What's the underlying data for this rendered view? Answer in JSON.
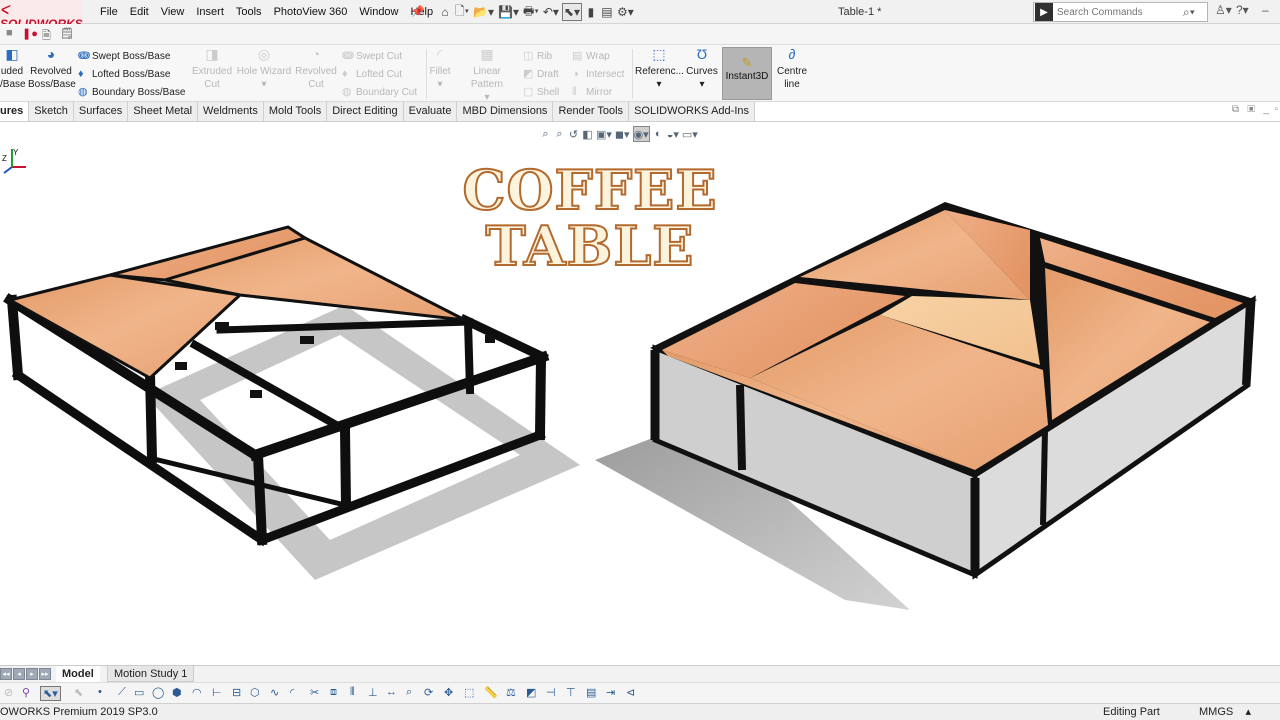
{
  "app": {
    "brand": "SOLIDWORKS",
    "document_title": "Table-1 *",
    "menus": [
      "File",
      "Edit",
      "View",
      "Insert",
      "Tools",
      "PhotoView 360",
      "Window",
      "Help"
    ]
  },
  "search": {
    "placeholder": "Search Commands"
  },
  "ribbon": {
    "extruded_label_1": "uded",
    "extruded_label_2": "/Base",
    "revolved_boss_label_1": "Revolved",
    "revolved_boss_label_2": "Boss/Base",
    "swept_boss": "Swept Boss/Base",
    "lofted_boss": "Lofted Boss/Base",
    "boundary_boss": "Boundary Boss/Base",
    "extruded_cut_1": "Extruded",
    "extruded_cut_2": "Cut",
    "hole_wizard": "Hole Wizard",
    "revolved_cut_1": "Revolved",
    "revolved_cut_2": "Cut",
    "swept_cut": "Swept Cut",
    "lofted_cut": "Lofted Cut",
    "boundary_cut": "Boundary Cut",
    "fillet": "Fillet",
    "linear_pattern": "Linear Pattern",
    "rib": "Rib",
    "draft": "Draft",
    "shell": "Shell",
    "wrap": "Wrap",
    "intersect": "Intersect",
    "mirror": "Mirror",
    "reference": "Referenc...",
    "curves": "Curves",
    "instant3d": "Instant3D",
    "centreline_1": "Centre",
    "centreline_2": "line"
  },
  "command_tabs": [
    "ures",
    "Sketch",
    "Surfaces",
    "Sheet Metal",
    "Weldments",
    "Mold Tools",
    "Direct Editing",
    "Evaluate",
    "MBD Dimensions",
    "Render Tools",
    "SOLIDWORKS Add-Ins"
  ],
  "viewport": {
    "title_line1": "COFFEE",
    "title_line2": "TABLE",
    "triad_label_y": "Y",
    "triad_label_z": "Z"
  },
  "bottom_tabs": {
    "model": "Model",
    "motion": "Motion Study 1"
  },
  "status": {
    "version": "OWORKS Premium 2019 SP3.0",
    "mode": "Editing Part",
    "units": "MMGS"
  },
  "colors": {
    "brand_red": "#c8102e",
    "wood": "#eba877",
    "frame": "#111111",
    "title_fill": "#fbf3dc",
    "title_outline": "#b36a2e"
  }
}
